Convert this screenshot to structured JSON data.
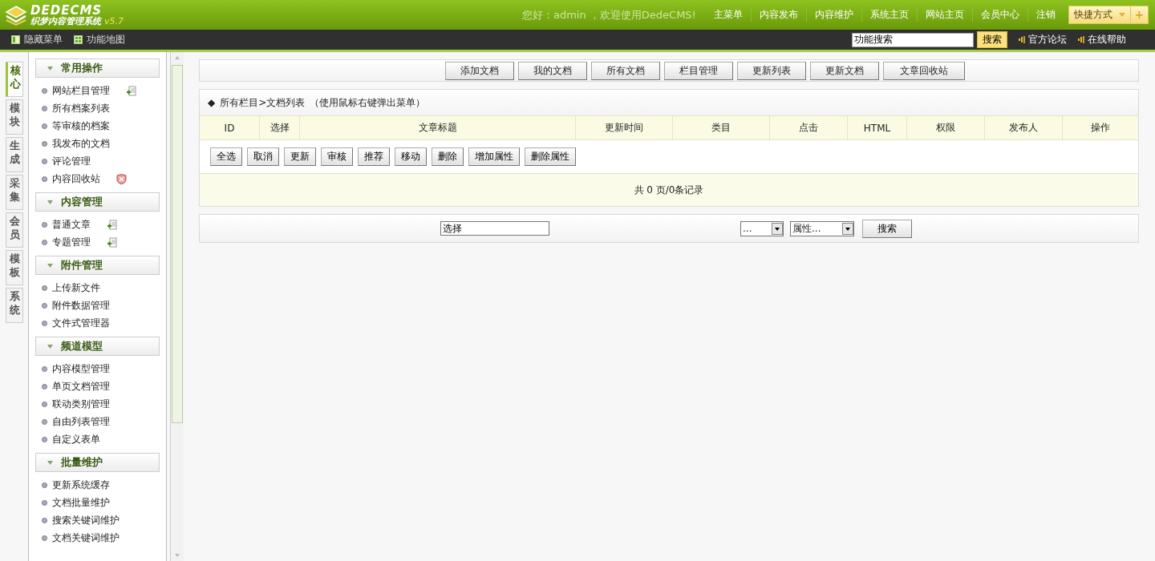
{
  "header": {
    "logo": {
      "title": "DEDECMS",
      "subtitle": "织梦内容管理系统",
      "version": "v5.7"
    },
    "greeting": "您好：admin ，欢迎使用DedeCMS!",
    "nav": [
      "主菜单",
      "内容发布",
      "内容维护",
      "系统主页",
      "网站主页",
      "会员中心",
      "注销"
    ],
    "shortcut": {
      "label": "快捷方式",
      "add": "+"
    }
  },
  "toolbar": {
    "links": [
      {
        "label": "隐藏菜单",
        "kind": "panel"
      },
      {
        "label": "功能地图",
        "kind": "grid"
      }
    ],
    "search": {
      "value": "功能搜索",
      "button": "搜索"
    },
    "help_links": [
      "官方论坛",
      "在线帮助"
    ]
  },
  "side_tabs": [
    {
      "label": "核心",
      "selected": true
    },
    {
      "label": "模块",
      "selected": false
    },
    {
      "label": "生成",
      "selected": false
    },
    {
      "label": "采集",
      "selected": false
    },
    {
      "label": "会员",
      "selected": false
    },
    {
      "label": "模板",
      "selected": false
    },
    {
      "label": "系统",
      "selected": false
    }
  ],
  "menu": [
    {
      "title": "常用操作",
      "expanded": true,
      "items": [
        {
          "label": "网站栏目管理",
          "kind": "add"
        },
        {
          "label": "所有档案列表"
        },
        {
          "label": "等审核的档案"
        },
        {
          "label": "我发布的文档"
        },
        {
          "label": "评论管理"
        },
        {
          "label": "内容回收站",
          "kind": "clear"
        }
      ]
    },
    {
      "title": "内容管理",
      "expanded": true,
      "items": [
        {
          "label": "普通文章",
          "kind": "add"
        },
        {
          "label": "专题管理",
          "kind": "add"
        }
      ]
    },
    {
      "title": "附件管理",
      "expanded": true,
      "items": [
        {
          "label": "上传新文件"
        },
        {
          "label": "附件数据管理"
        },
        {
          "label": "文件式管理器"
        }
      ]
    },
    {
      "title": "频道模型",
      "expanded": true,
      "items": [
        {
          "label": "内容模型管理"
        },
        {
          "label": "单页文档管理"
        },
        {
          "label": "联动类别管理"
        },
        {
          "label": "自由列表管理"
        },
        {
          "label": "自定义表单"
        }
      ]
    },
    {
      "title": "批量维护",
      "expanded": true,
      "items": [
        {
          "label": "更新系统缓存"
        },
        {
          "label": "文档批量维护"
        },
        {
          "label": "搜索关键词维护"
        },
        {
          "label": "文档关键词维护"
        }
      ]
    }
  ],
  "main": {
    "top_buttons": [
      "添加文档",
      "我的文档",
      "所有文档",
      "栏目管理",
      "更新列表",
      "更新文档",
      "文章回收站"
    ],
    "breadcrumb": {
      "marker": "◆",
      "path": "所有栏目>文档列表",
      "hint": "（使用鼠标右键弹出菜单）"
    },
    "columns": [
      "ID",
      "选择",
      "文章标题",
      "更新时间",
      "类目",
      "点击",
      "HTML",
      "权限",
      "发布人",
      "操作"
    ],
    "action_buttons": [
      "全选",
      "取消",
      "更新",
      "审核",
      "推荐",
      "移动",
      "删除",
      "增加属性",
      "删除属性"
    ],
    "pager": "共 0 页/0条记录",
    "filter": {
      "keyword": "选择",
      "select_1": "...",
      "select_2": "属性...",
      "button": "搜索"
    }
  }
}
